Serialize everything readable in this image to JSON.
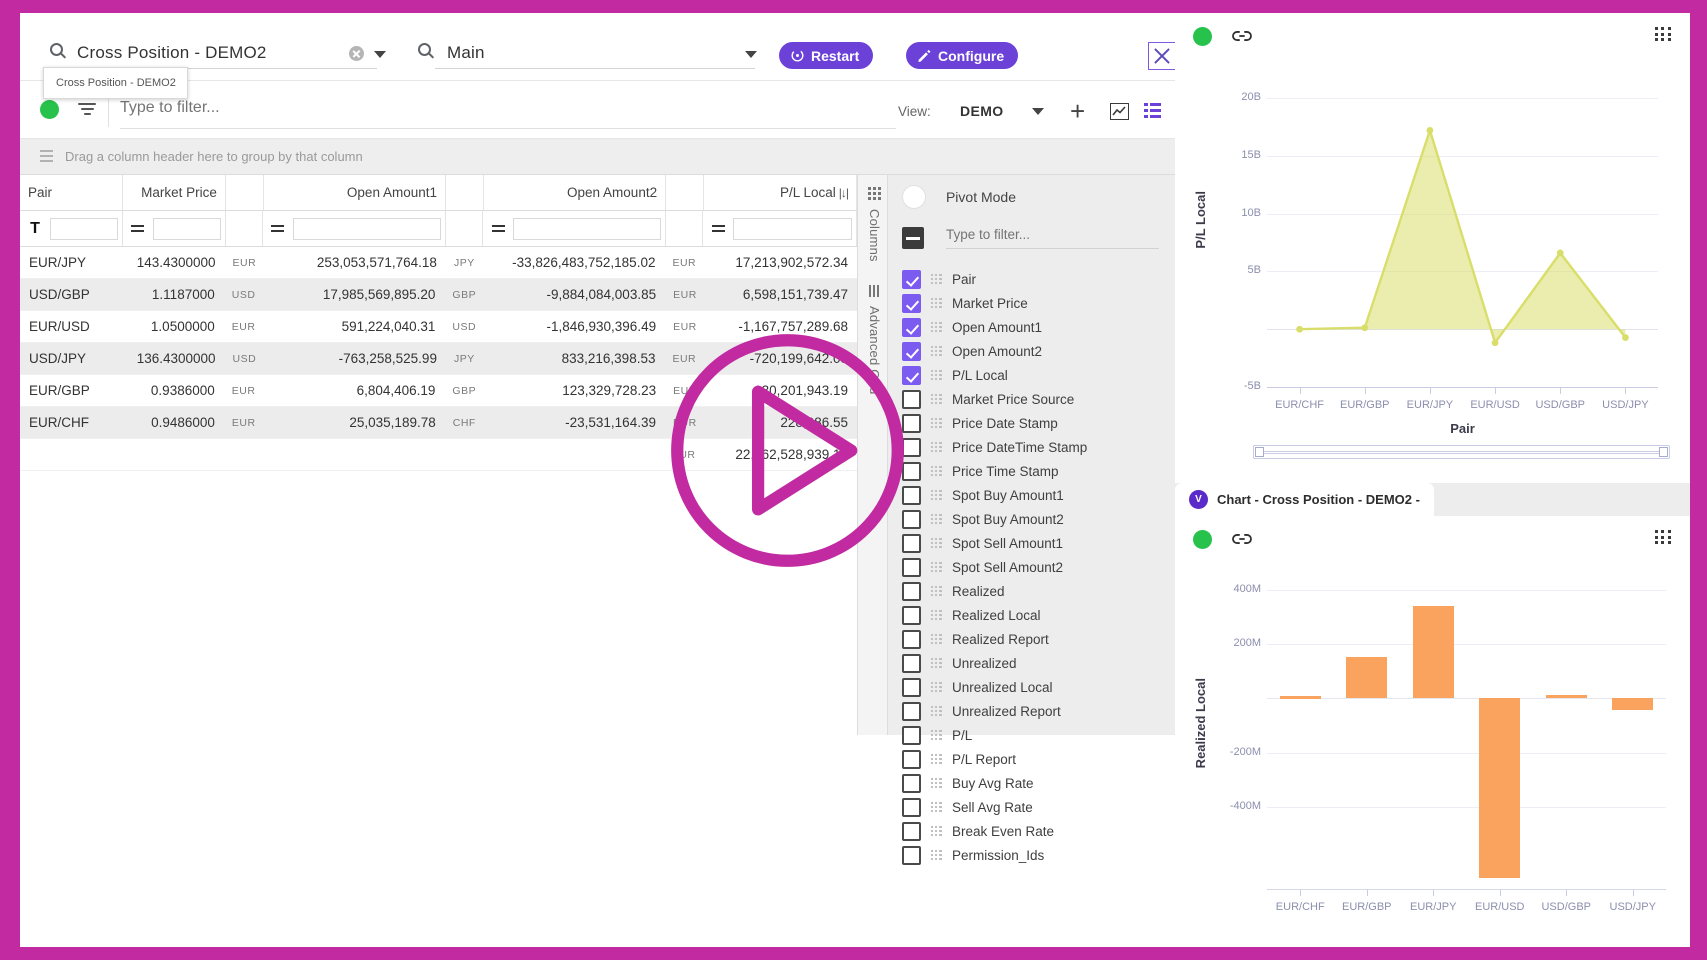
{
  "window": {
    "frame_color": "#c12aa0"
  },
  "topbar": {
    "search_icon": "search-icon",
    "search_value": "Cross Position - DEMO2",
    "tooltip": "Cross Position - DEMO2",
    "search2_icon": "search-icon",
    "main_value": "Main",
    "restart_label": "Restart",
    "configure_label": "Configure",
    "close_icon": "close-icon"
  },
  "filterbar": {
    "status_icon": "green-status-dot",
    "filter_icon": "filter-icon",
    "filter_placeholder": "Type to filter...",
    "filter_value": "",
    "view_label": "View:",
    "view_value": "DEMO",
    "add_icon": "plus-icon",
    "chart_icon": "chart-icon",
    "grid_icon": "grid-icon"
  },
  "groupbar": {
    "text": "Drag a column header here to group by that column"
  },
  "grid": {
    "columns": [
      {
        "label": "Pair",
        "align": "left"
      },
      {
        "label": "Market Price",
        "align": "right"
      },
      {
        "label": "Open Amount1",
        "align": "right"
      },
      {
        "label": "Open Amount2",
        "align": "right"
      },
      {
        "label": "P/L Local",
        "align": "right",
        "sort": "|↓|"
      }
    ],
    "filter_row": {
      "text_op": "T",
      "num_op": "="
    },
    "rows": [
      {
        "pair": "EUR/JPY",
        "price": "143.4300000",
        "cur1": "EUR",
        "amt1": "253,053,571,764.18",
        "cur2": "JPY",
        "amt2": "-33,826,483,752,185.02",
        "cur3": "EUR",
        "pl": "17,213,902,572.34"
      },
      {
        "pair": "USD/GBP",
        "price": "1.1187000",
        "cur1": "USD",
        "amt1": "17,985,569,895.20",
        "cur2": "GBP",
        "amt2": "-9,884,084,003.85",
        "cur3": "EUR",
        "pl": "6,598,151,739.47"
      },
      {
        "pair": "EUR/USD",
        "price": "1.0500000",
        "cur1": "EUR",
        "amt1": "591,224,040.31",
        "cur2": "USD",
        "amt2": "-1,846,930,396.49",
        "cur3": "EUR",
        "pl": "-1,167,757,289.68"
      },
      {
        "pair": "USD/JPY",
        "price": "136.4300000",
        "cur1": "USD",
        "amt1": "-763,258,525.99",
        "cur2": "JPY",
        "amt2": "833,216,398.53",
        "cur3": "EUR",
        "pl": "-720,199,642.08"
      },
      {
        "pair": "EUR/GBP",
        "price": "0.9386000",
        "cur1": "EUR",
        "amt1": "6,804,406.19",
        "cur2": "GBP",
        "amt2": "123,329,728.23",
        "cur3": "EUR",
        "pl": "130,201,943.19"
      },
      {
        "pair": "EUR/CHF",
        "price": "0.9486000",
        "cur1": "EUR",
        "amt1": "25,035,189.78",
        "cur2": "CHF",
        "amt2": "-23,531,164.39",
        "cur3": "EUR",
        "pl": "228,986.55"
      }
    ],
    "total_row": {
      "pair": "",
      "price": "",
      "cur1": "",
      "amt1": "",
      "cur2": "",
      "amt2": "",
      "cur3": "EUR",
      "pl": "22,062,528,939.10"
    }
  },
  "rail": {
    "columns_label": "Columns",
    "advanced_grid_label": "Advanced Grid"
  },
  "toolpanel": {
    "pivot_mode_label": "Pivot Mode",
    "filter_placeholder": "Type to filter...",
    "items": [
      {
        "label": "Pair",
        "checked": true
      },
      {
        "label": "Market Price",
        "checked": true
      },
      {
        "label": "Open Amount1",
        "checked": true
      },
      {
        "label": "Open Amount2",
        "checked": true
      },
      {
        "label": "P/L Local",
        "checked": true
      },
      {
        "label": "Market Price Source",
        "checked": false
      },
      {
        "label": "Price Date Stamp",
        "checked": false
      },
      {
        "label": "Price DateTime Stamp",
        "checked": false
      },
      {
        "label": "Price Time Stamp",
        "checked": false
      },
      {
        "label": "Spot Buy Amount1",
        "checked": false
      },
      {
        "label": "Spot Buy Amount2",
        "checked": false
      },
      {
        "label": "Spot Sell Amount1",
        "checked": false
      },
      {
        "label": "Spot Sell Amount2",
        "checked": false
      },
      {
        "label": "Realized",
        "checked": false
      },
      {
        "label": "Realized Local",
        "checked": false
      },
      {
        "label": "Realized Report",
        "checked": false
      },
      {
        "label": "Unrealized",
        "checked": false
      },
      {
        "label": "Unrealized Local",
        "checked": false
      },
      {
        "label": "Unrealized Report",
        "checked": false
      },
      {
        "label": "P/L",
        "checked": false
      },
      {
        "label": "P/L Report",
        "checked": false
      },
      {
        "label": "Buy Avg Rate",
        "checked": false
      },
      {
        "label": "Sell Avg Rate",
        "checked": false
      },
      {
        "label": "Break Even Rate",
        "checked": false
      },
      {
        "label": "Permission_Ids",
        "checked": false
      }
    ]
  },
  "charts": {
    "tab": {
      "badge": "V",
      "label": "Chart - Cross Position - DEMO2 -"
    },
    "link_icon": "link-icon",
    "status_icon": "green-status-dot",
    "menu_icon": "grid-menu-icon"
  },
  "chart_data": [
    {
      "type": "area",
      "title": "",
      "xlabel": "Pair",
      "ylabel": "P/L Local",
      "categories": [
        "EUR/CHF",
        "EUR/GBP",
        "EUR/JPY",
        "EUR/USD",
        "USD/GBP",
        "USD/JPY"
      ],
      "values": [
        0.000229,
        0.13,
        17.21,
        -1.17,
        6.6,
        -0.72
      ],
      "value_unit": "B",
      "yticks": [
        "-5B",
        "5B",
        "10B",
        "15B",
        "20B"
      ],
      "ylim": [
        -5,
        22
      ],
      "grid": true,
      "legend": "none",
      "series_color": "#d9de6a"
    },
    {
      "type": "bar",
      "title": "",
      "xlabel": "",
      "ylabel": "Realized Local",
      "categories": [
        "EUR/CHF",
        "EUR/GBP",
        "EUR/JPY",
        "EUR/USD",
        "USD/GBP",
        "USD/JPY"
      ],
      "values": [
        8,
        152,
        340,
        -660,
        11,
        -42
      ],
      "value_unit": "M",
      "yticks": [
        "400M",
        "200M",
        "-200M",
        "-400M"
      ],
      "ylim": [
        -700,
        450
      ],
      "grid": true,
      "legend": "none",
      "series_color": "#faa35e"
    }
  ]
}
